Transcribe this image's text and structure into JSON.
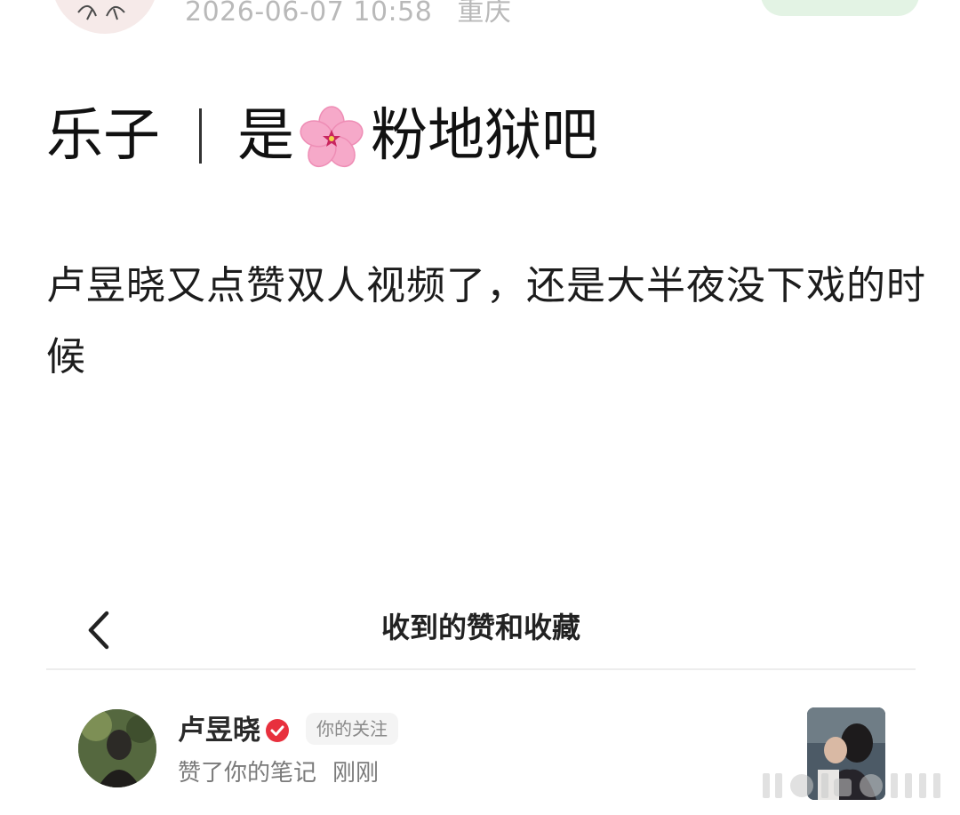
{
  "author_meta": {
    "date": "2026-06-07 10:58",
    "location": "重庆"
  },
  "post": {
    "title_part1": "乐子",
    "title_part2": "是",
    "title_part3": "粉地狱吧",
    "body": "卢昱晓又点赞双人视频了，还是大半夜没下戏的时候",
    "flower_icon": "cherry-blossom-icon"
  },
  "embedded_screen": {
    "title": "收到的赞和收藏",
    "notification": {
      "user_name": "卢昱晓",
      "follow_tag": "你的关注",
      "action": "赞了你的笔记",
      "time": "刚刚"
    }
  },
  "colors": {
    "meta_text": "#b9b9b9",
    "verified_red": "#e8303d",
    "follow_pill_green": "#e3f3e4",
    "flower_pink": "#f6a9c9"
  }
}
